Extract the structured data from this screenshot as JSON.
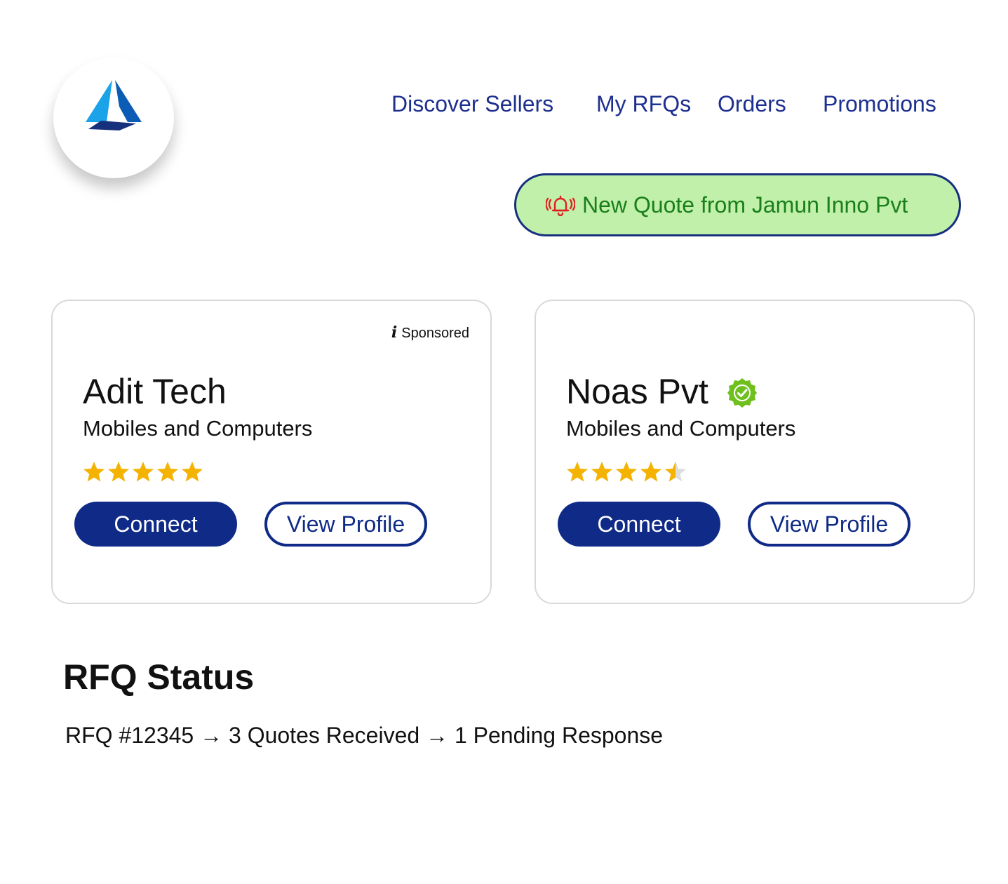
{
  "nav": {
    "items": [
      {
        "label": "Discover Sellers"
      },
      {
        "label": "My RFQs"
      },
      {
        "label": "Orders"
      },
      {
        "label": "Promotions"
      }
    ]
  },
  "notification": {
    "icon": "bell-ring-icon",
    "text": "New Quote from Jamun Inno Pvt"
  },
  "cards": [
    {
      "badge": "Sponsored",
      "badge_icon": "info-icon",
      "name": "Adit Tech",
      "category": "Mobiles and Computers",
      "rating": 5,
      "rating_max": 5,
      "connect_label": "Connect",
      "view_label": "View Profile"
    },
    {
      "name": "Noas Pvt",
      "verified": true,
      "verified_icon": "verified-check-icon",
      "category": "Mobiles and Computers",
      "rating": 4.5,
      "rating_max": 5,
      "connect_label": "Connect",
      "view_label": "View Profile"
    }
  ],
  "rfq": {
    "title": "RFQ Status",
    "line": "RFQ #12345 → 3 Quotes Received → 1 Pending Response"
  },
  "colors": {
    "brand_blue": "#0f2a87",
    "nav_blue": "#1d2f8f",
    "notify_bg": "#c1f0ab",
    "notify_text": "#1a7f1a",
    "star": "#f5b301",
    "verified": "#6fc01e"
  }
}
